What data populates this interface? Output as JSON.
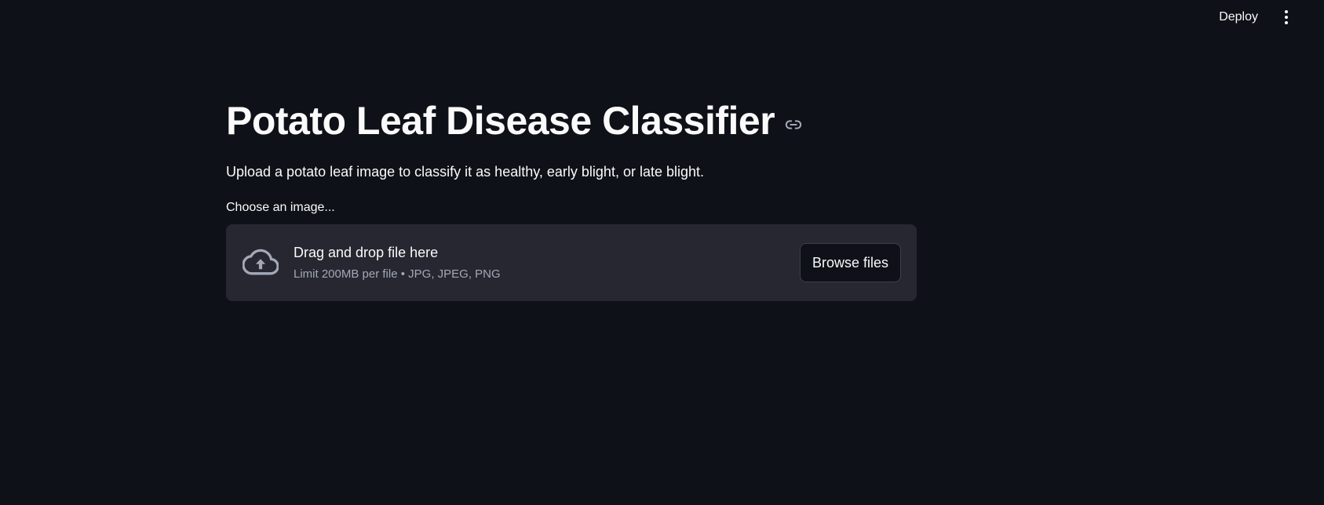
{
  "header": {
    "deploy_label": "Deploy",
    "menu_icon": "vertical-ellipsis-icon"
  },
  "main": {
    "title": "Potato Leaf Disease Classifier",
    "title_anchor_icon": "link-icon",
    "description": "Upload a potato leaf image to classify it as healthy, early blight, or late blight."
  },
  "uploader": {
    "label": "Choose an image...",
    "icon": "cloud-upload-icon",
    "drop_text": "Drag and drop file here",
    "limit_text": "Limit 200MB per file • JPG, JPEG, PNG",
    "browse_label": "Browse files"
  },
  "colors": {
    "background": "#0e1117",
    "dropzone": "#262730",
    "text": "#fafafa",
    "muted_text": "#a3a8b8"
  }
}
